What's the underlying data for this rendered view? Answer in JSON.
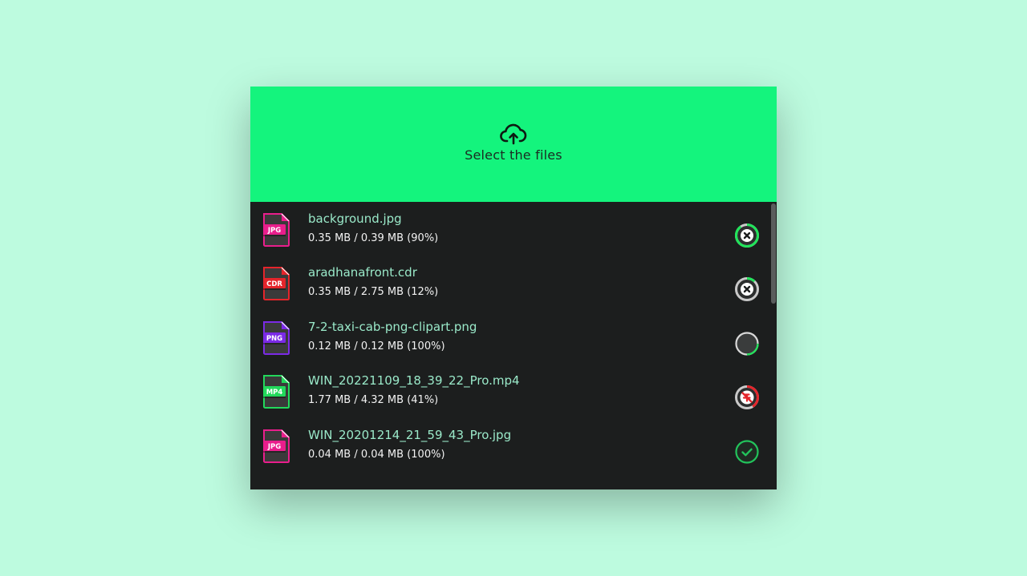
{
  "dropzone": {
    "label": "Select the files",
    "icon": "cloud-upload-icon"
  },
  "colors": {
    "page_bg": "#bdfbdf",
    "card_bg": "#1c1e1e",
    "accent": "#14f47d",
    "filename": "#9ae9c9",
    "error": "#e4252b",
    "success": "#22c35b"
  },
  "files": [
    {
      "name": "background.jpg",
      "size": "0.35 MB / 0.39 MB (90%)",
      "type": "JPG",
      "type_color": "#e91e8c",
      "progress": 0.9,
      "action_icon": "cancel-icon",
      "state": "uploading"
    },
    {
      "name": "aradhanafront.cdr",
      "size": "0.35 MB / 2.75 MB (12%)",
      "type": "CDR",
      "type_color": "#e4252b",
      "progress": 0.12,
      "action_icon": "cancel-icon",
      "state": "uploading"
    },
    {
      "name": "7-2-taxi-cab-png-clipart.png",
      "size": "0.12 MB / 0.12 MB (100%)",
      "type": "PNG",
      "type_color": "#7b2ae6",
      "progress": 1.0,
      "action_icon": "processing-icon",
      "state": "processing"
    },
    {
      "name": "WIN_20221109_18_39_22_Pro.mp4",
      "size": "1.77 MB / 4.32 MB (41%)",
      "type": "MP4",
      "type_color": "#22d85b",
      "progress": 0.41,
      "action_icon": "paused-error-icon",
      "state": "failed"
    },
    {
      "name": "WIN_20201214_21_59_43_Pro.jpg",
      "size": "0.04 MB / 0.04 MB (100%)",
      "type": "JPG",
      "type_color": "#e91e8c",
      "progress": 1.0,
      "action_icon": "check-icon",
      "state": "done"
    }
  ]
}
